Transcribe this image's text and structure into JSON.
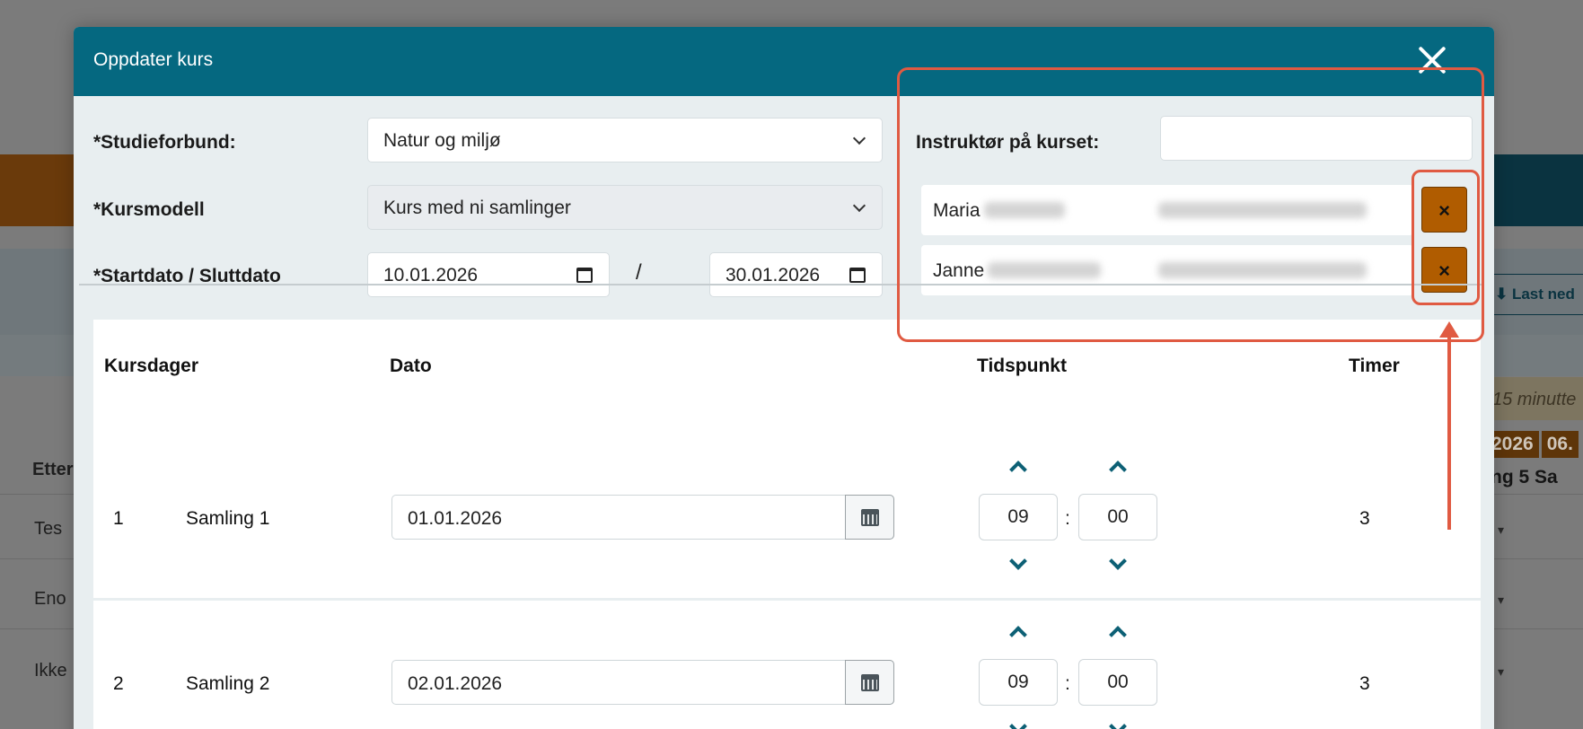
{
  "background": {
    "last_ned": "Last ned",
    "notice": "15 minutte",
    "dates": [
      "2026",
      "06."
    ],
    "samling": "ng 5   Sa",
    "column_prefix": "Etter",
    "rows": [
      "Tes",
      "Eno",
      "Ikke"
    ]
  },
  "modal": {
    "title": "Oppdater kurs",
    "studieforbund_label": "*Studieforbund:",
    "studieforbund_value": "Natur og miljø",
    "kursmodell_label": "*Kursmodell",
    "kursmodell_value": "Kurs med ni samlinger",
    "dato_label": "*Startdato / Sluttdato",
    "startdato": "10.01.2026",
    "slash": "/",
    "sluttdato": "30.01.2026",
    "instruktor_label": "Instruktør på kurset:",
    "instruktor_input_value": "",
    "instructors": [
      {
        "first_name": "Maria",
        "remove": "×"
      },
      {
        "first_name": "Janne",
        "remove": "×"
      }
    ]
  },
  "table": {
    "headers": {
      "kursdager": "Kursdager",
      "dato": "Dato",
      "tidspunkt": "Tidspunkt",
      "timer": "Timer"
    },
    "rows": [
      {
        "nr": "1",
        "name": "Samling 1",
        "date": "01.01.2026",
        "hour": "09",
        "minute": "00",
        "colon": ":",
        "timer": "3"
      },
      {
        "nr": "2",
        "name": "Samling 2",
        "date": "02.01.2026",
        "hour": "09",
        "minute": "00",
        "colon": ":",
        "timer": "3"
      }
    ]
  },
  "colors": {
    "header_teal": "#056880",
    "remove_button": "#b05c00",
    "annotation": "#e05a42"
  }
}
